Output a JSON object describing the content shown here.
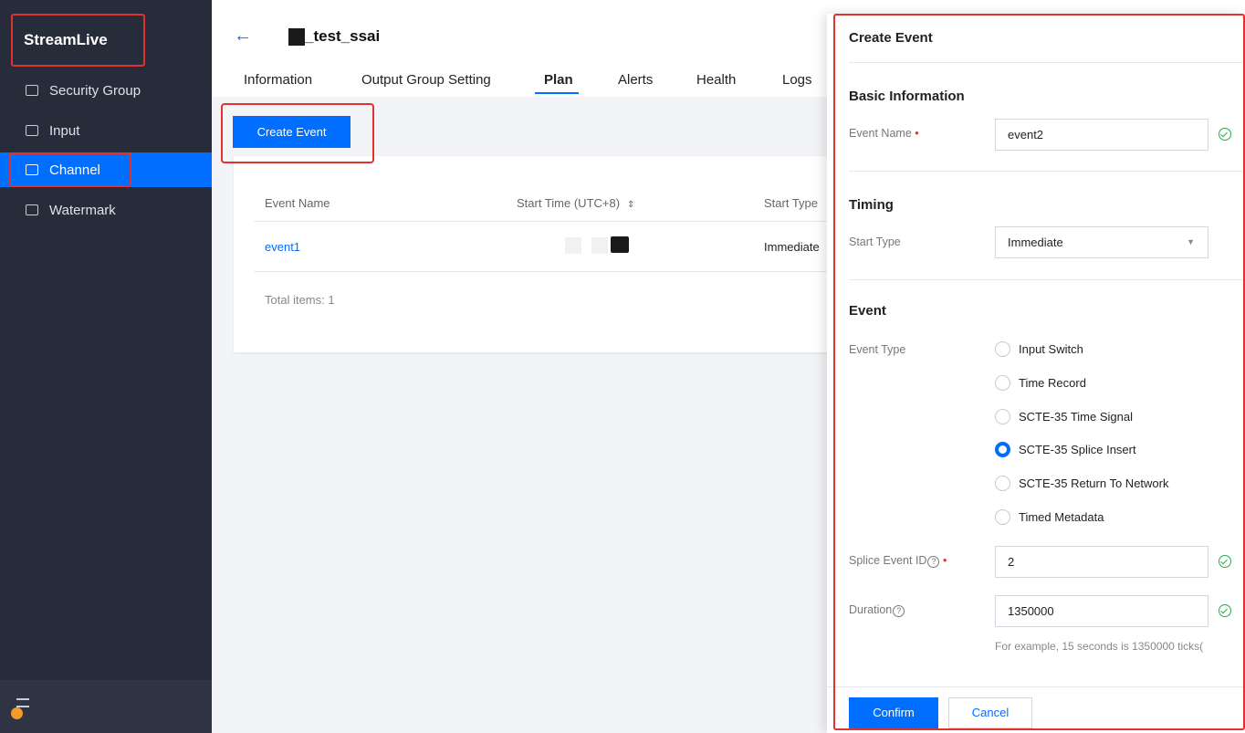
{
  "sidebar": {
    "brand": "StreamLive",
    "items": [
      {
        "label": "Security Group",
        "icon": "shield-icon"
      },
      {
        "label": "Input",
        "icon": "input-icon"
      },
      {
        "label": "Channel",
        "icon": "channel-icon",
        "active": true
      },
      {
        "label": "Watermark",
        "icon": "watermark-icon"
      }
    ]
  },
  "header": {
    "channel_title": "_test_ssai",
    "tabs": [
      "Information",
      "Output Group Setting",
      "Plan",
      "Alerts",
      "Health",
      "Logs"
    ],
    "active_tab": "Plan"
  },
  "plan": {
    "create_button": "Create Event",
    "columns": [
      "Event Name",
      "Start Time (UTC+8)",
      "Start Type"
    ],
    "rows": [
      {
        "event_name": "event1",
        "start_type": "Immediate"
      }
    ],
    "total": "Total items: 1"
  },
  "drawer": {
    "title": "Create Event",
    "basic_info": "Basic Information",
    "event_name_label": "Event Name",
    "event_name_value": "event2",
    "timing": "Timing",
    "start_type_label": "Start Type",
    "start_type_value": "Immediate",
    "event_section": "Event",
    "event_type_label": "Event Type",
    "event_types": [
      "Input Switch",
      "Time Record",
      "SCTE-35 Time Signal",
      "SCTE-35 Splice Insert",
      "SCTE-35 Return To Network",
      "Timed Metadata"
    ],
    "selected_event_type": "SCTE-35 Splice Insert",
    "splice_id_label": "Splice Event ID",
    "splice_id_value": "2",
    "duration_label": "Duration",
    "duration_value": "1350000",
    "duration_hint": "For example, 15 seconds is 1350000 ticks(",
    "confirm": "Confirm",
    "cancel": "Cancel"
  },
  "colors": {
    "accent": "#006eff",
    "sidebar_bg": "#262c3a",
    "highlight": "#e0332e",
    "success": "#29a844"
  }
}
